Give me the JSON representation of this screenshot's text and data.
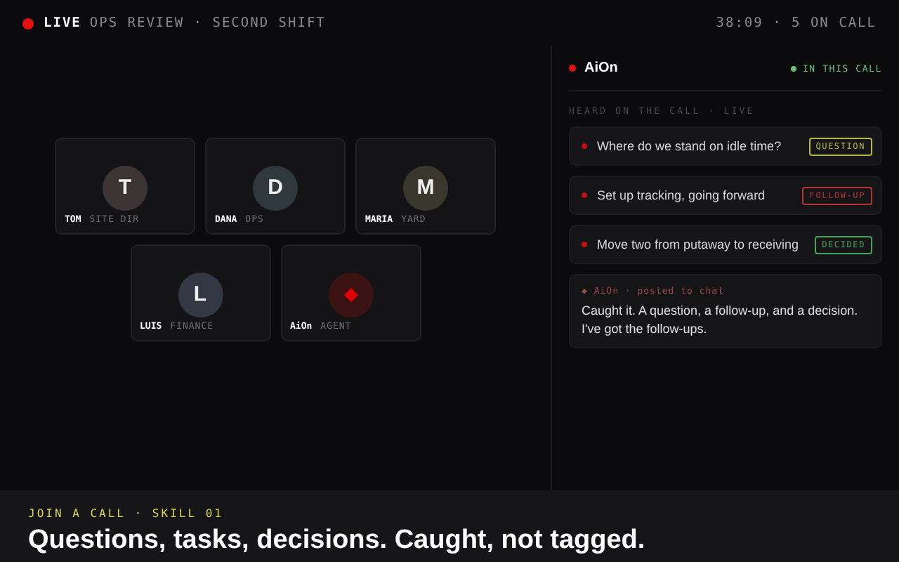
{
  "top_bar": {
    "live": "LIVE",
    "title": "OPS REVIEW · SECOND SHIFT",
    "status": "38:09 · 5 ON CALL"
  },
  "participants": [
    {
      "initial": "T",
      "name": "TOM",
      "role": "SITE DIR",
      "color": "#3d3436",
      "kind": "person"
    },
    {
      "initial": "D",
      "name": "DANA",
      "role": "OPS",
      "color": "#2f393d",
      "kind": "person"
    },
    {
      "initial": "M",
      "name": "MARIA",
      "role": "YARD",
      "color": "#3a372e",
      "kind": "person"
    },
    {
      "initial": "L",
      "name": "LUIS",
      "role": "FINANCE",
      "color": "#343844",
      "kind": "person"
    },
    {
      "name": "AiOn",
      "role": "AGENT",
      "color": "#3a1212",
      "kind": "agent"
    }
  ],
  "panel": {
    "agent": "AiOn",
    "status": "IN THIS CALL",
    "section": "HEARD ON THE CALL · LIVE",
    "items": [
      {
        "text": "Where do we stand on idle time?",
        "tag": "QUESTION",
        "kind": "question"
      },
      {
        "text": "Set up tracking, going forward",
        "tag": "FOLLOW-UP",
        "kind": "followup"
      },
      {
        "text": "Move two from putaway to receiving",
        "tag": "DECIDED",
        "kind": "decided"
      }
    ],
    "chat": {
      "meta": "◆ AiOn · posted to chat",
      "text": "Caught it. A question, a follow-up, and a decision. I've got the follow-ups."
    }
  },
  "footer": {
    "eyebrow": "JOIN A CALL · SKILL 01",
    "headline": "Questions, tasks, decisions. Caught, not tagged."
  }
}
